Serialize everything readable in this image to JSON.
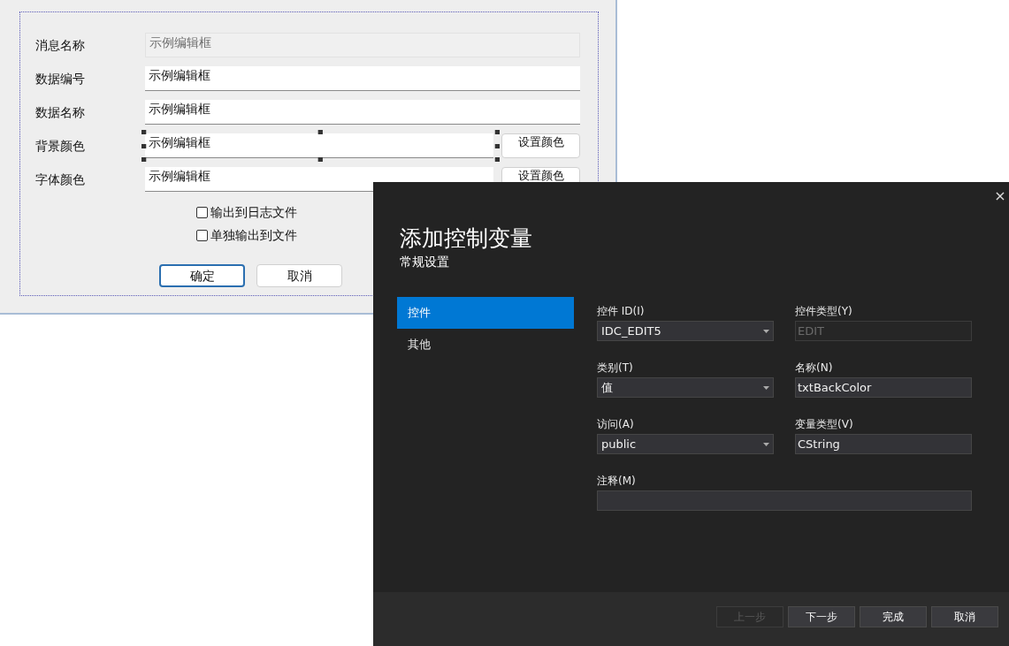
{
  "designer": {
    "fields": [
      {
        "label": "消息名称",
        "value": "示例编辑框",
        "disabled": true,
        "selected": false
      },
      {
        "label": "数据编号",
        "value": "示例编辑框",
        "disabled": false,
        "selected": false
      },
      {
        "label": "数据名称",
        "value": "示例编辑框",
        "disabled": false,
        "selected": false
      },
      {
        "label": "背景颜色",
        "value": "示例编辑框",
        "disabled": false,
        "selected": true,
        "button": "设置颜色"
      },
      {
        "label": "字体颜色",
        "value": "示例编辑框",
        "disabled": false,
        "selected": false,
        "button": "设置颜色"
      }
    ],
    "checkboxes": [
      {
        "label": "输出到日志文件",
        "checked": false
      },
      {
        "label": "单独输出到文件",
        "checked": false
      }
    ],
    "buttons": [
      {
        "label": "确定",
        "focused": true
      },
      {
        "label": "取消",
        "focused": false
      }
    ]
  },
  "dialog": {
    "close": "×",
    "title": "添加控制变量",
    "subtitle": "常规设置",
    "nav": [
      {
        "label": "控件",
        "selected": true
      },
      {
        "label": "其他",
        "selected": false
      }
    ],
    "fields": [
      {
        "label": "控件 ID(I)",
        "value": "IDC_EDIT5",
        "kind": "dropdown",
        "disabled": false
      },
      {
        "label": "控件类型(Y)",
        "value": "EDIT",
        "kind": "text",
        "disabled": true
      },
      {
        "label": "类别(T)",
        "value": "值",
        "kind": "dropdown",
        "disabled": false
      },
      {
        "label": "名称(N)",
        "value": "txtBackColor",
        "kind": "text",
        "disabled": false
      },
      {
        "label": "访问(A)",
        "value": "public",
        "kind": "dropdown",
        "disabled": false
      },
      {
        "label": "变量类型(V)",
        "value": "CString",
        "kind": "text",
        "disabled": false
      },
      {
        "label": "注释(M)",
        "kind": "note",
        "disabled": false
      }
    ],
    "buttons": [
      {
        "label": "上一步",
        "disabled": true
      },
      {
        "label": "下一步",
        "disabled": false
      },
      {
        "label": "完成",
        "disabled": false
      },
      {
        "label": "取消",
        "disabled": false
      }
    ]
  }
}
